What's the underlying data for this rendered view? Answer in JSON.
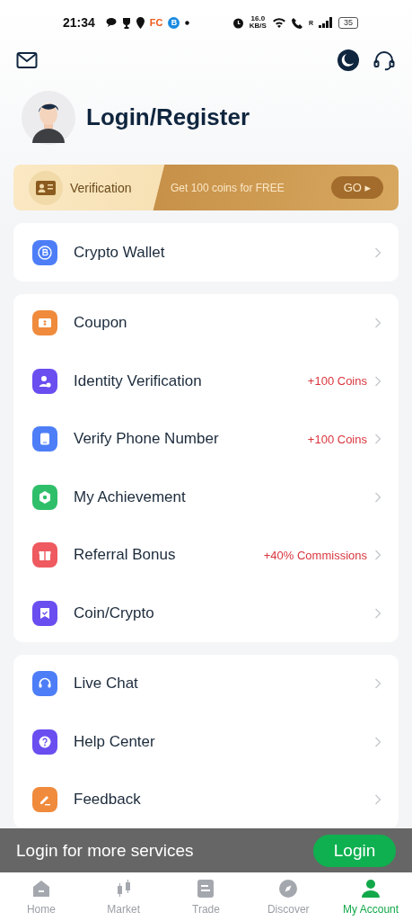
{
  "status_bar": {
    "time": "21:34",
    "app_badges": [
      "FC",
      "B"
    ],
    "speed": "16.0",
    "speed_unit": "KB/S",
    "network_letter": "R",
    "battery": "35"
  },
  "profile": {
    "title": "Login/Register"
  },
  "banner": {
    "label": "Verification",
    "offer": "Get 100 coins for FREE",
    "button": "GO ▸"
  },
  "groups": [
    {
      "items": [
        {
          "label": "Crypto Wallet",
          "color": "#4d7ef7"
        }
      ]
    },
    {
      "items": [
        {
          "label": "Coupon",
          "color": "#f08a3c"
        },
        {
          "label": "Identity Verification",
          "reward": "+100 Coins",
          "color": "#6a4ef0"
        },
        {
          "label": "Verify Phone Number",
          "reward": "+100 Coins",
          "color": "#4d7ef7"
        },
        {
          "label": "My Achievement",
          "color": "#2fbf6a"
        },
        {
          "label": "Referral Bonus",
          "reward": "+40% Commissions",
          "color": "#ee5a5f"
        },
        {
          "label": "Coin/Crypto",
          "color": "#6a4ef0"
        }
      ]
    },
    {
      "items": [
        {
          "label": "Live Chat",
          "color": "#4d7ef7"
        },
        {
          "label": "Help Center",
          "color": "#6a4ef0"
        },
        {
          "label": "Feedback",
          "color": "#f08a3c"
        }
      ]
    }
  ],
  "login_prompt": {
    "text": "Login for more services",
    "button": "Login"
  },
  "tabs": [
    {
      "label": "Home",
      "selected": false
    },
    {
      "label": "Market",
      "selected": false
    },
    {
      "label": "Trade",
      "selected": false
    },
    {
      "label": "Discover",
      "selected": false
    },
    {
      "label": "My Account",
      "selected": true
    }
  ]
}
